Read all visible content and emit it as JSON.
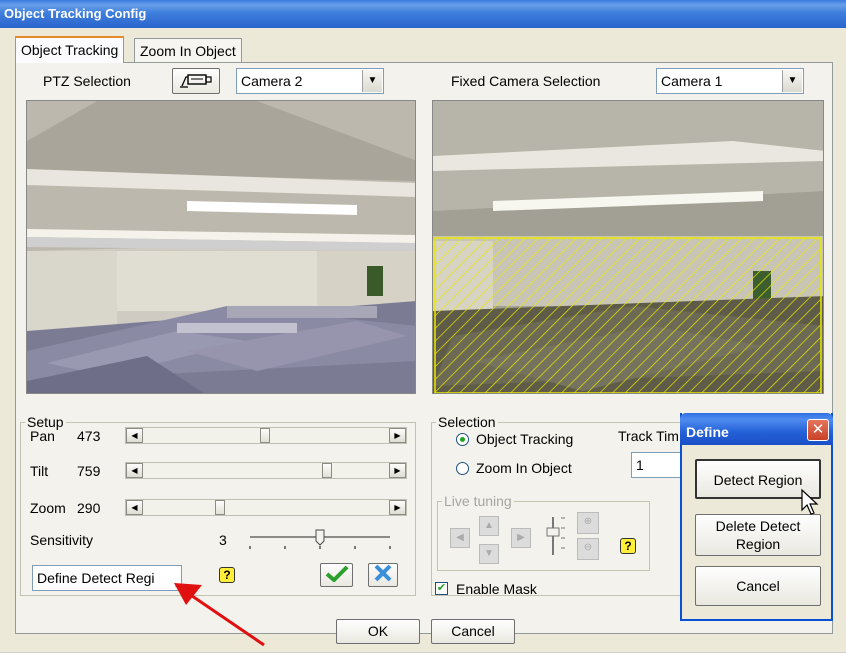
{
  "window": {
    "title": "Object Tracking Config"
  },
  "tabs": [
    {
      "label": "Object Tracking",
      "active": true
    },
    {
      "label": "Zoom In Object",
      "active": false
    }
  ],
  "ptz": {
    "label": "PTZ Selection",
    "camera": "Camera 2",
    "icon": "ptz-camera-icon"
  },
  "fixed": {
    "label": "Fixed Camera Selection",
    "camera": "Camera 1"
  },
  "setup": {
    "legend": "Setup",
    "pan": {
      "label": "Pan",
      "value": "473",
      "level": 0.52
    },
    "tilt": {
      "label": "Tilt",
      "value": "759",
      "level": 0.76
    },
    "zoom": {
      "label": "Zoom",
      "value": "290",
      "level": 0.35
    },
    "sensitivity": {
      "label": "Sensitivity",
      "value": "3",
      "level": 0.5
    },
    "mode_select": "Define Detect Regi",
    "help": "?"
  },
  "selection": {
    "legend": "Selection",
    "options": [
      "Object Tracking",
      "Zoom In Object"
    ],
    "selected": "Object Tracking",
    "track_time_label": "Track Tim",
    "track_time_value": "1"
  },
  "live_tuning": {
    "legend": "Live tuning",
    "help": "?"
  },
  "enable_mask": {
    "label": "Enable Mask",
    "checked": true
  },
  "footer": {
    "ok": "OK",
    "cancel": "Cancel"
  },
  "popup": {
    "title": "Define",
    "buttons": [
      "Detect Region",
      "Delete Detect Region",
      "Cancel"
    ]
  },
  "colors": {
    "titlebar": "#2a64cc",
    "annotation_arrow": "#e01010",
    "mask_hatch": "#e8e800"
  }
}
